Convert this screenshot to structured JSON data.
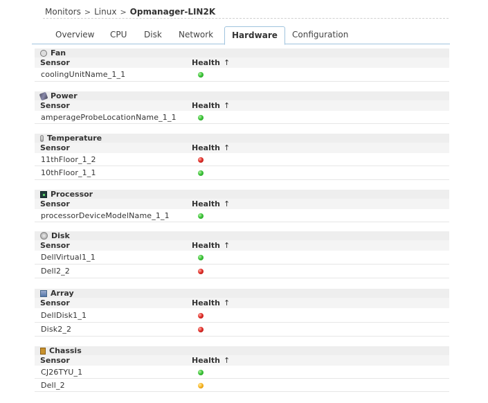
{
  "breadcrumb": {
    "items": [
      "Monitors",
      "Linux"
    ],
    "separator": ">",
    "current": "Opmanager-LIN2K"
  },
  "tabs": [
    "Overview",
    "CPU",
    "Disk",
    "Network",
    "Hardware",
    "Configuration"
  ],
  "active_tab": "Hardware",
  "columns": {
    "sensor": "Sensor",
    "health": "Health",
    "sort_arrow": "↑"
  },
  "status_colors": {
    "green": "#3cc43a",
    "red": "#e0302a",
    "orange": "#f6b21e"
  },
  "sections": [
    {
      "title": "Fan",
      "icon": "fan-icon",
      "rows": [
        {
          "name": "coolingUnitName_1_1",
          "health": "green"
        }
      ]
    },
    {
      "title": "Power",
      "icon": "power-icon",
      "rows": [
        {
          "name": "amperageProbeLocationName_1_1",
          "health": "green"
        }
      ]
    },
    {
      "title": "Temperature",
      "icon": "thermometer-icon",
      "rows": [
        {
          "name": "11thFloor_1_2",
          "health": "red"
        },
        {
          "name": "10thFloor_1_1",
          "health": "green"
        }
      ]
    },
    {
      "title": "Processor",
      "icon": "processor-icon",
      "rows": [
        {
          "name": "processorDeviceModelName_1_1",
          "health": "green"
        }
      ]
    },
    {
      "title": "Disk",
      "icon": "disk-icon",
      "rows": [
        {
          "name": "DellVirtual1_1",
          "health": "green"
        },
        {
          "name": "Dell2_2",
          "health": "red"
        }
      ]
    },
    {
      "title": "Array",
      "icon": "array-icon",
      "rows": [
        {
          "name": "DellDisk1_1",
          "health": "red"
        },
        {
          "name": "Disk2_2",
          "health": "red"
        }
      ]
    },
    {
      "title": "Chassis",
      "icon": "chassis-icon",
      "rows": [
        {
          "name": "CJ26TYU_1",
          "health": "green"
        },
        {
          "name": "Dell_2",
          "health": "orange"
        }
      ]
    }
  ]
}
